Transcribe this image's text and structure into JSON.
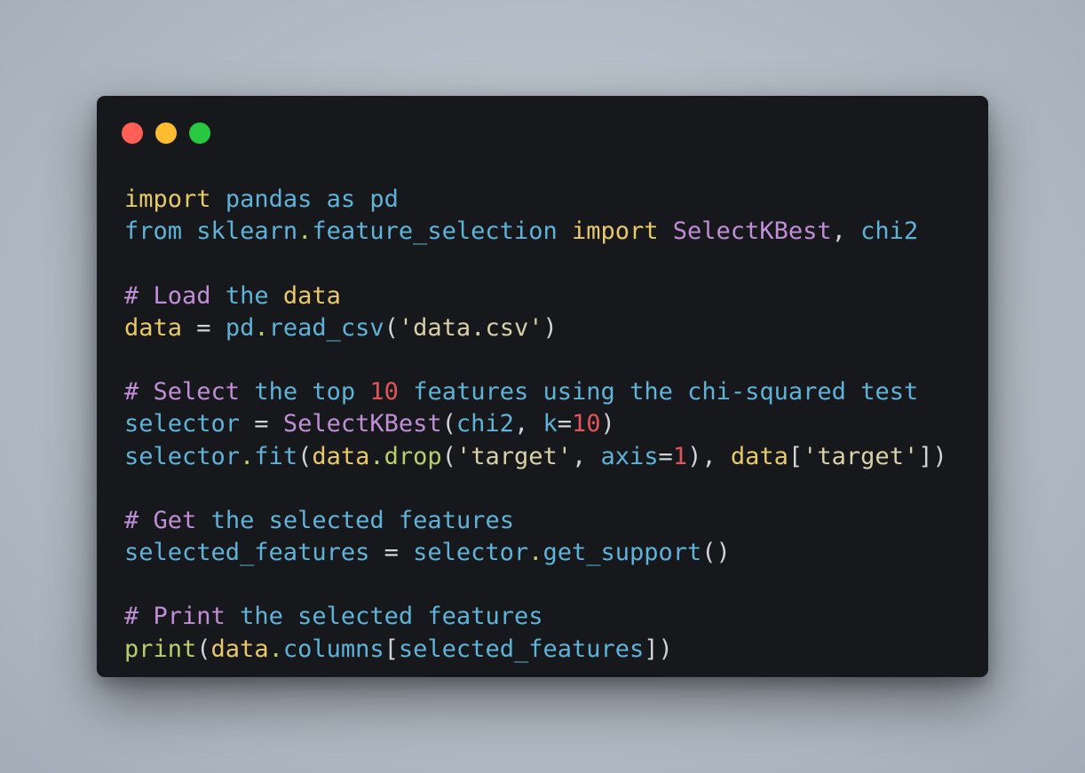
{
  "window": {
    "traffic_lights": [
      {
        "name": "close-button",
        "color": "#ff5f57"
      },
      {
        "name": "minimize-button",
        "color": "#febc2e"
      },
      {
        "name": "zoom-button",
        "color": "#28c840"
      }
    ]
  },
  "palette": {
    "keyword": "#e8c96a",
    "ident": "#5fb3d9",
    "class": "#c08ed6",
    "comment": "#c08ed6",
    "string": "#d8d0a8",
    "number": "#e0555c",
    "punct": "#d0d3d8",
    "func": "#b9cf6c",
    "attr": "#e8c96a"
  },
  "code": {
    "lines": [
      [
        [
          "import",
          "keyword"
        ],
        [
          " ",
          "punct"
        ],
        [
          "pandas",
          "ident"
        ],
        [
          " ",
          "punct"
        ],
        [
          "as",
          "ident"
        ],
        [
          " ",
          "punct"
        ],
        [
          "pd",
          "ident"
        ]
      ],
      [
        [
          "from",
          "ident"
        ],
        [
          " ",
          "punct"
        ],
        [
          "sklearn",
          "ident"
        ],
        [
          ".",
          "func"
        ],
        [
          "feature_selection",
          "ident"
        ],
        [
          " ",
          "punct"
        ],
        [
          "import",
          "keyword"
        ],
        [
          " ",
          "punct"
        ],
        [
          "SelectKBest",
          "class"
        ],
        [
          ", ",
          "punct"
        ],
        [
          "chi2",
          "ident"
        ]
      ],
      [],
      [
        [
          "# ",
          "comment"
        ],
        [
          "Load",
          "comment"
        ],
        [
          " ",
          "punct"
        ],
        [
          "the",
          "ident"
        ],
        [
          " ",
          "punct"
        ],
        [
          "data",
          "keyword"
        ]
      ],
      [
        [
          "data",
          "keyword"
        ],
        [
          " = ",
          "punct"
        ],
        [
          "pd",
          "ident"
        ],
        [
          ".",
          "func"
        ],
        [
          "read_csv",
          "ident"
        ],
        [
          "(",
          "punct"
        ],
        [
          "'data.csv'",
          "string"
        ],
        [
          ")",
          "punct"
        ]
      ],
      [],
      [
        [
          "# ",
          "comment"
        ],
        [
          "Select",
          "comment"
        ],
        [
          " ",
          "punct"
        ],
        [
          "the",
          "ident"
        ],
        [
          " ",
          "punct"
        ],
        [
          "top",
          "ident"
        ],
        [
          " ",
          "punct"
        ],
        [
          "10",
          "number"
        ],
        [
          " ",
          "punct"
        ],
        [
          "features",
          "ident"
        ],
        [
          " ",
          "punct"
        ],
        [
          "using",
          "ident"
        ],
        [
          " ",
          "punct"
        ],
        [
          "the",
          "ident"
        ],
        [
          " ",
          "punct"
        ],
        [
          "chi-squared",
          "ident"
        ],
        [
          " ",
          "punct"
        ],
        [
          "test",
          "ident"
        ]
      ],
      [
        [
          "selector",
          "ident"
        ],
        [
          " = ",
          "punct"
        ],
        [
          "SelectKBest",
          "class"
        ],
        [
          "(",
          "punct"
        ],
        [
          "chi2",
          "ident"
        ],
        [
          ", ",
          "punct"
        ],
        [
          "k",
          "ident"
        ],
        [
          "=",
          "punct"
        ],
        [
          "10",
          "number"
        ],
        [
          ")",
          "punct"
        ]
      ],
      [
        [
          "selector",
          "ident"
        ],
        [
          ".",
          "func"
        ],
        [
          "fit",
          "ident"
        ],
        [
          "(",
          "punct"
        ],
        [
          "data",
          "keyword"
        ],
        [
          ".",
          "func"
        ],
        [
          "drop",
          "func"
        ],
        [
          "(",
          "punct"
        ],
        [
          "'target'",
          "string"
        ],
        [
          ", ",
          "punct"
        ],
        [
          "axis",
          "ident"
        ],
        [
          "=",
          "punct"
        ],
        [
          "1",
          "number"
        ],
        [
          "), ",
          "punct"
        ],
        [
          "data",
          "keyword"
        ],
        [
          "[",
          "punct"
        ],
        [
          "'target'",
          "string"
        ],
        [
          "])",
          "punct"
        ]
      ],
      [],
      [
        [
          "# ",
          "comment"
        ],
        [
          "Get",
          "comment"
        ],
        [
          " ",
          "punct"
        ],
        [
          "the",
          "ident"
        ],
        [
          " ",
          "punct"
        ],
        [
          "selected",
          "ident"
        ],
        [
          " ",
          "punct"
        ],
        [
          "features",
          "ident"
        ]
      ],
      [
        [
          "selected_features",
          "ident"
        ],
        [
          " = ",
          "punct"
        ],
        [
          "selector",
          "ident"
        ],
        [
          ".",
          "func"
        ],
        [
          "get_support",
          "ident"
        ],
        [
          "()",
          "punct"
        ]
      ],
      [],
      [
        [
          "# ",
          "comment"
        ],
        [
          "Print",
          "comment"
        ],
        [
          " ",
          "punct"
        ],
        [
          "the",
          "ident"
        ],
        [
          " ",
          "punct"
        ],
        [
          "selected",
          "ident"
        ],
        [
          " ",
          "punct"
        ],
        [
          "features",
          "ident"
        ]
      ],
      [
        [
          "print",
          "func"
        ],
        [
          "(",
          "punct"
        ],
        [
          "data",
          "keyword"
        ],
        [
          ".",
          "func"
        ],
        [
          "columns",
          "ident"
        ],
        [
          "[",
          "punct"
        ],
        [
          "selected_features",
          "ident"
        ],
        [
          "])",
          "punct"
        ]
      ]
    ]
  }
}
